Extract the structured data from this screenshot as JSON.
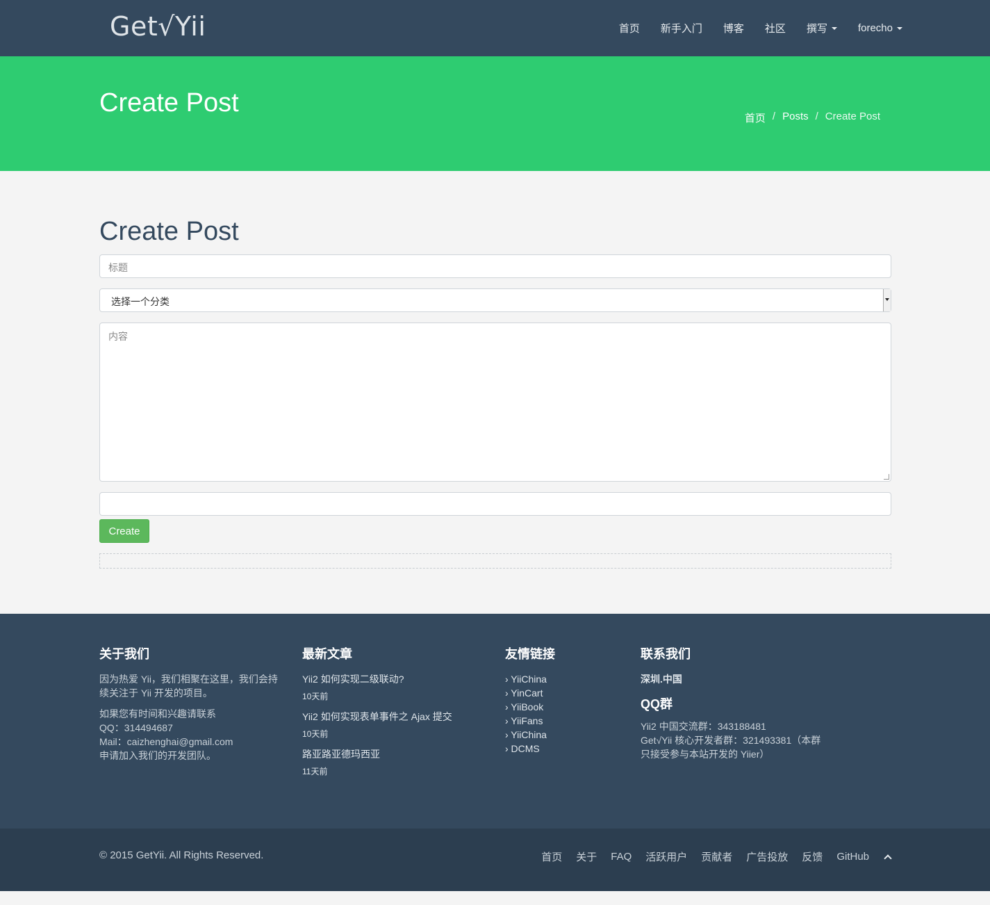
{
  "navbar": {
    "brand": "Get√Yii",
    "items": [
      {
        "label": "首页"
      },
      {
        "label": "新手入门"
      },
      {
        "label": "博客"
      },
      {
        "label": "社区"
      },
      {
        "label": "撰写",
        "dropdown": true
      },
      {
        "label": "forecho",
        "dropdown": true
      }
    ]
  },
  "header": {
    "title": "Create Post",
    "breadcrumb": [
      "首页",
      "Posts",
      "Create Post"
    ]
  },
  "form": {
    "heading": "Create Post",
    "title_placeholder": "标题",
    "category_selected": "选择一个分类",
    "content_placeholder": "内容",
    "extra_value": "",
    "submit_label": "Create"
  },
  "footer": {
    "about": {
      "heading": "关于我们",
      "text1": "因为热爱 Yii，我们相聚在这里，我们会持续关注于 Yii 开发的项目。",
      "text2_line1": "如果您有时间和兴趣请联系",
      "text2_line2": "QQ：314494687",
      "text2_line3": "Mail：caizhenghai@gmail.com",
      "text2_line4": "申请加入我们的开发团队。"
    },
    "latest": {
      "heading": "最新文章",
      "posts": [
        {
          "title": "Yii2 如何实现二级联动?",
          "time": "10天前"
        },
        {
          "title": "Yii2 如何实现表单事件之 Ajax 提交",
          "time": "10天前"
        },
        {
          "title": "路亚路亚德玛西亚",
          "time": "11天前"
        }
      ]
    },
    "links": {
      "heading": "友情链接",
      "items": [
        "› YiiChina",
        "› YinCart",
        "› YiiBook",
        "› YiiFans",
        "› YiiChina",
        "› DCMS"
      ]
    },
    "contact": {
      "heading": "联系我们",
      "city": "深圳.中国",
      "qq_heading": "QQ群",
      "line1": "Yii2 中国交流群：343188481",
      "line2": "Get√Yii 核心开发者群：321493381（本群只接受参与本站开发的 Yiier）"
    }
  },
  "bottom": {
    "copyright": "© 2015 GetYii. All Rights Reserved.",
    "links": [
      "首页",
      "关于",
      "FAQ",
      "活跃用户",
      "贡献者",
      "广告投放",
      "反馈",
      "GitHub"
    ]
  }
}
